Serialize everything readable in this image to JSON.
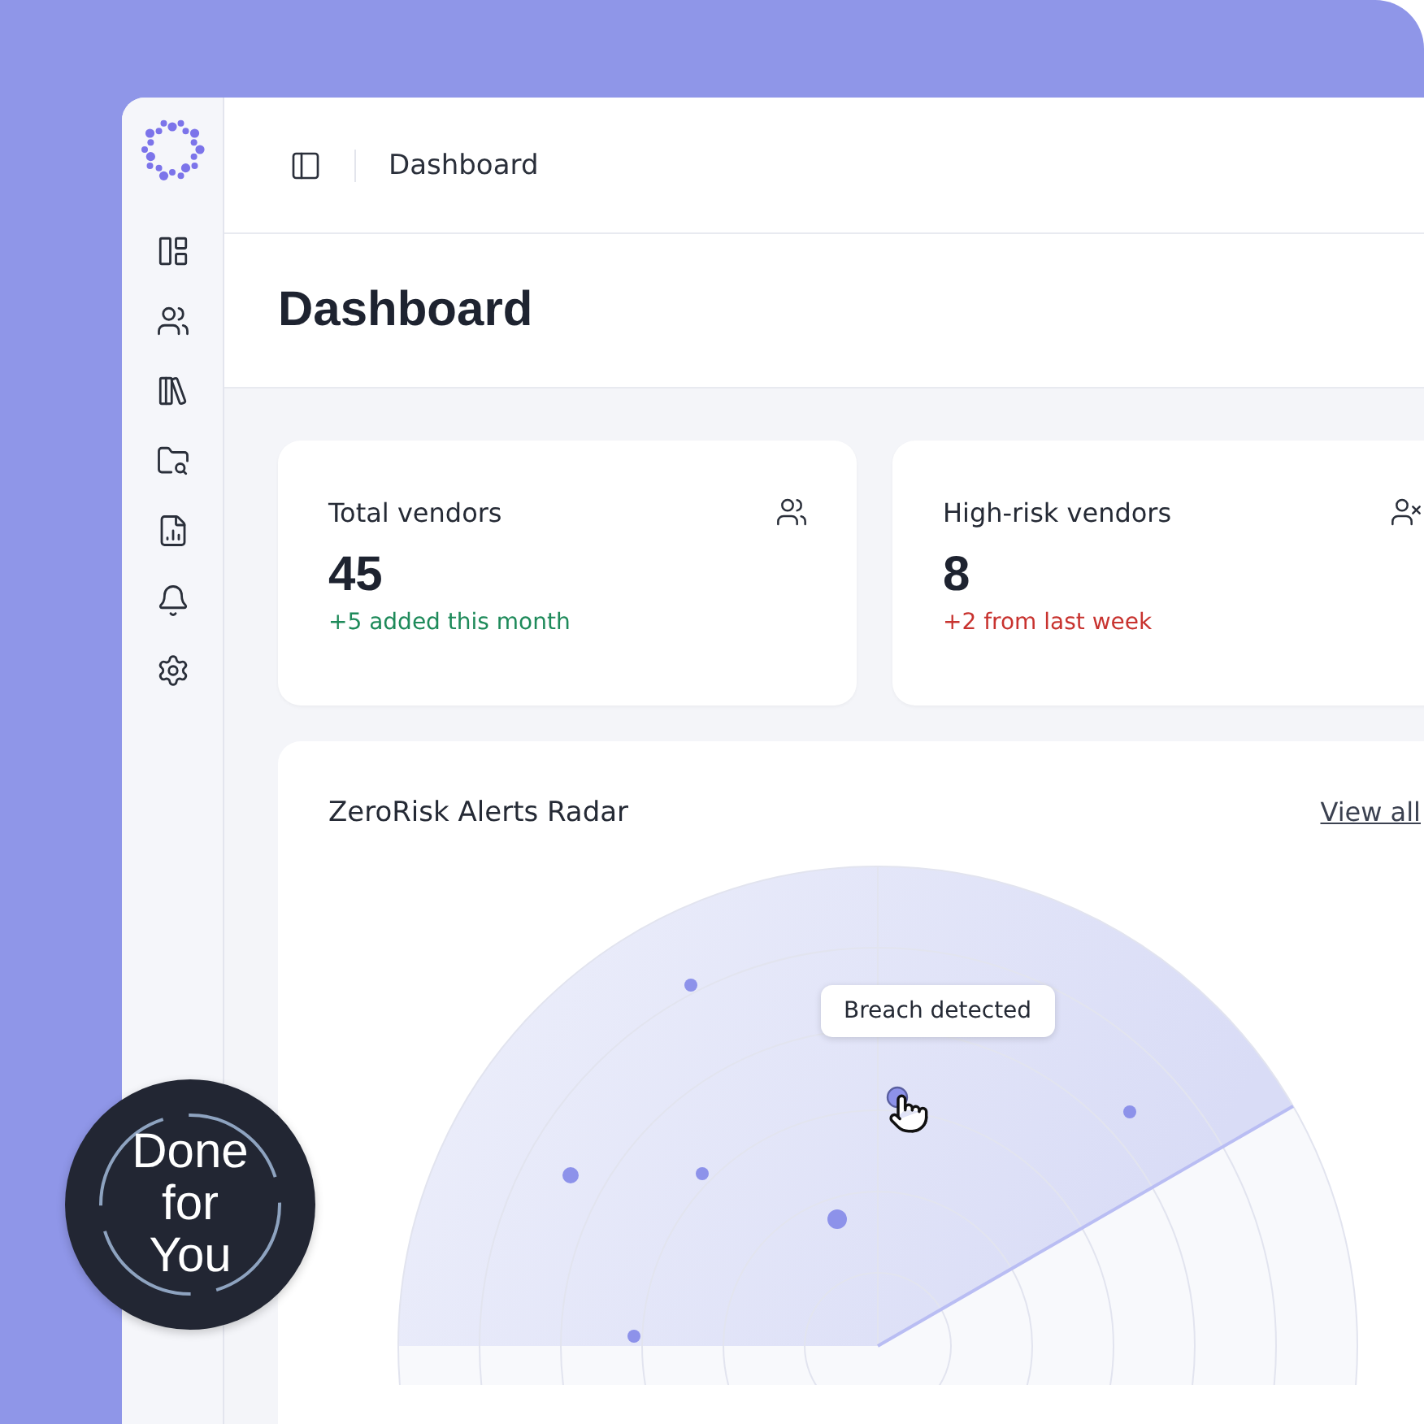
{
  "header": {
    "breadcrumb": "Dashboard"
  },
  "page_title": "Dashboard",
  "stats": [
    {
      "label": "Total vendors",
      "value": "45",
      "change": "+5 added this month",
      "kind": "positive"
    },
    {
      "label": "High-risk vendors",
      "value": "8",
      "change": "+2 from last week",
      "kind": "negative"
    }
  ],
  "radar": {
    "title": "ZeroRisk Alerts Radar",
    "link": "View all",
    "tooltip": "Breach detected"
  },
  "badge": {
    "lines": [
      "Done",
      "for",
      "You"
    ]
  }
}
